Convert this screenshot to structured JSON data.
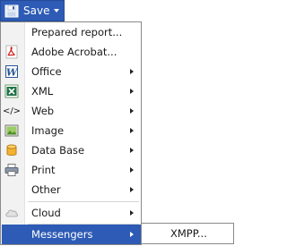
{
  "save_button": {
    "label": "Save",
    "icon": "floppy-disk-icon"
  },
  "menu": {
    "items": [
      {
        "label": "Prepared report...",
        "icon": "none",
        "submenu": false
      },
      {
        "label": "Adobe Acrobat...",
        "icon": "pdf-icon",
        "submenu": false
      },
      {
        "label": "Office",
        "icon": "word-icon",
        "submenu": true
      },
      {
        "label": "XML",
        "icon": "excel-xml-icon",
        "submenu": true
      },
      {
        "label": "Web",
        "icon": "code-tag-icon",
        "icon_text": "</>",
        "submenu": true
      },
      {
        "label": "Image",
        "icon": "image-icon",
        "submenu": true
      },
      {
        "label": "Data Base",
        "icon": "database-icon",
        "submenu": true
      },
      {
        "label": "Print",
        "icon": "printer-icon",
        "submenu": true
      },
      {
        "label": "Other",
        "icon": "none",
        "submenu": true
      },
      {
        "label": "Cloud",
        "icon": "cloud-icon",
        "submenu": true
      },
      {
        "label": "Messengers",
        "icon": "none",
        "submenu": true,
        "active": true
      }
    ]
  },
  "submenu": {
    "items": [
      {
        "label": "XMPP..."
      }
    ]
  },
  "colors": {
    "accent": "#2d5bb5",
    "gutter": "#f2f2f2",
    "border": "#8a8a8a"
  }
}
